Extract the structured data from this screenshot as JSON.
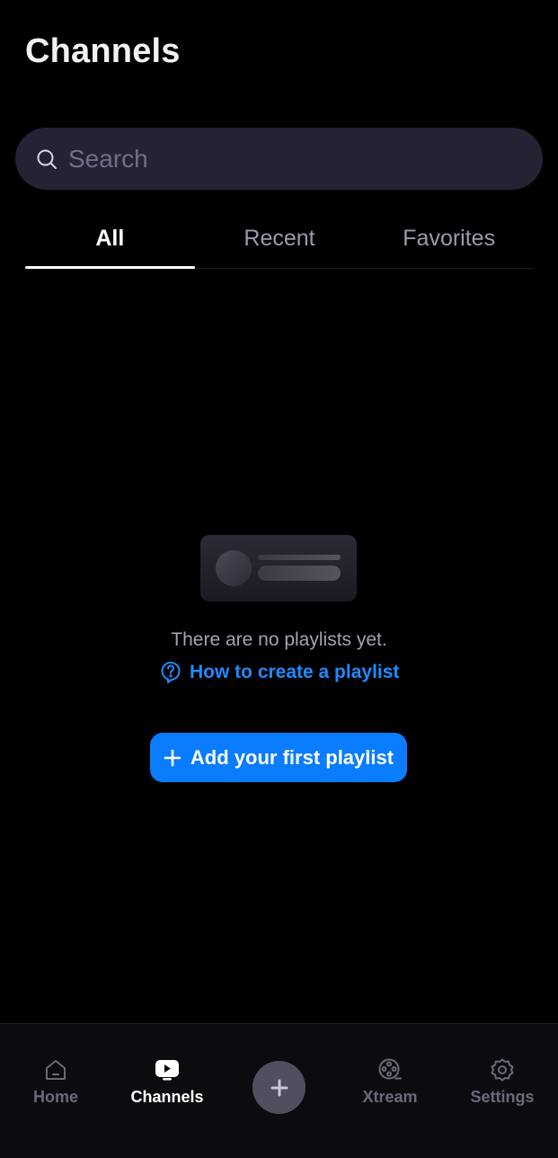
{
  "header": {
    "title": "Channels"
  },
  "search": {
    "placeholder": "Search",
    "value": ""
  },
  "tabs": [
    {
      "label": "All",
      "active": true
    },
    {
      "label": "Recent",
      "active": false
    },
    {
      "label": "Favorites",
      "active": false
    }
  ],
  "empty_state": {
    "message": "There are no playlists yet.",
    "help_link": "How to create a playlist",
    "add_button": "Add your first playlist"
  },
  "bottom_nav": {
    "items": [
      {
        "label": "Home",
        "icon": "home-icon",
        "active": false
      },
      {
        "label": "Channels",
        "icon": "tv-icon",
        "active": true
      },
      {
        "label": "Xtream",
        "icon": "film-reel-icon",
        "active": false
      },
      {
        "label": "Settings",
        "icon": "gear-icon",
        "active": false
      }
    ],
    "fab_icon": "plus-icon"
  },
  "colors": {
    "background": "#000000",
    "accent": "#0a7cff",
    "link": "#1f8bff",
    "search_bg": "#232334",
    "inactive": "#6a6a7a"
  }
}
